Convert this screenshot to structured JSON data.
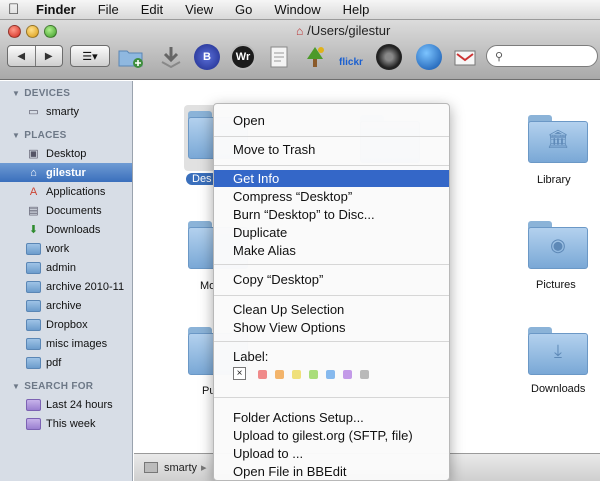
{
  "menubar": {
    "items": [
      "Finder",
      "File",
      "Edit",
      "View",
      "Go",
      "Window",
      "Help"
    ]
  },
  "window": {
    "title": "/Users/gilestur"
  },
  "toolbar": {
    "icons": [
      "new-folder-icon",
      "app-icon-b",
      "app-icon-wr",
      "app-icon-tree",
      "flickr-icon",
      "dvd-icon",
      "quicktime-icon",
      "app-icon-mail"
    ],
    "wr_label": "Wr",
    "b_label": "B",
    "flickr_label": "flickr"
  },
  "sidebar": {
    "sections": [
      {
        "title": "DEVICES",
        "items": [
          {
            "label": "smarty",
            "icon": "hard-drive-icon"
          }
        ]
      },
      {
        "title": "PLACES",
        "items": [
          {
            "label": "Desktop",
            "icon": "desktop-icon"
          },
          {
            "label": "gilestur",
            "icon": "home-icon",
            "selected": true
          },
          {
            "label": "Applications",
            "icon": "applications-icon"
          },
          {
            "label": "Documents",
            "icon": "documents-icon"
          },
          {
            "label": "Downloads",
            "icon": "downloads-icon"
          },
          {
            "label": "work",
            "icon": "folder-icon"
          },
          {
            "label": "admin",
            "icon": "folder-icon"
          },
          {
            "label": "archive 2010-11",
            "icon": "folder-icon"
          },
          {
            "label": "archive",
            "icon": "folder-icon"
          },
          {
            "label": "Dropbox",
            "icon": "folder-icon"
          },
          {
            "label": "misc images",
            "icon": "folder-icon"
          },
          {
            "label": "pdf",
            "icon": "folder-icon"
          }
        ]
      },
      {
        "title": "SEARCH FOR",
        "items": [
          {
            "label": "Last 24 hours",
            "icon": "smart-search-icon"
          },
          {
            "label": "This week",
            "icon": "smart-search-icon"
          }
        ]
      }
    ]
  },
  "content": {
    "folders": {
      "desktop": "Des",
      "library": "Library",
      "movies": "Mo",
      "pictures": "Pictures",
      "public": "Pu",
      "downloads": "Downloads"
    }
  },
  "pathbar": {
    "root": "smarty"
  },
  "context_menu": {
    "open": "Open",
    "move_to_trash": "Move to Trash",
    "get_info": "Get Info",
    "compress": "Compress “Desktop”",
    "burn": "Burn “Desktop” to Disc...",
    "duplicate": "Duplicate",
    "make_alias": "Make Alias",
    "copy": "Copy “Desktop”",
    "clean_up": "Clean Up Selection",
    "show_view_options": "Show View Options",
    "label": "Label:",
    "label_none": "×",
    "label_colors": [
      "#f08a8a",
      "#f3b46b",
      "#efe07a",
      "#a9dd7a",
      "#86b9ee",
      "#c39ae8",
      "#b9b9b9"
    ],
    "folder_actions": "Folder Actions Setup...",
    "upload_gilest": "Upload to gilest.org (SFTP, file)",
    "upload_to": "Upload to ...",
    "open_bbedit": "Open File in BBEdit"
  }
}
